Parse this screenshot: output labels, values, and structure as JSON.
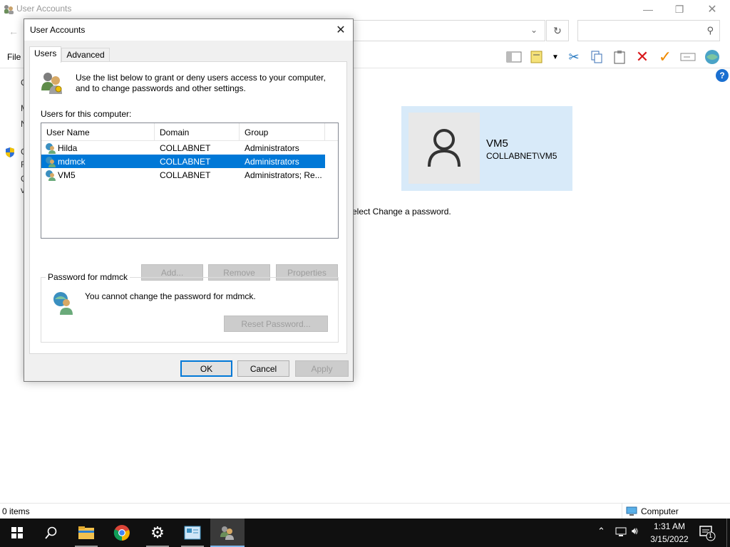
{
  "background_window": {
    "title": "User Accounts",
    "menu_file": "File",
    "user_tile": {
      "name": "VM5",
      "domain": "COLLABNET\\VM5"
    },
    "instruction_fragment": "elect Change a password.",
    "status_items": "0 items",
    "status_location": "Computer",
    "left_clip_chars": [
      "C",
      "M",
      "N",
      "C",
      "F",
      "C",
      "v"
    ]
  },
  "dialog": {
    "title": "User Accounts",
    "tabs": [
      {
        "label": "Users",
        "active": true
      },
      {
        "label": "Advanced",
        "active": false
      }
    ],
    "intro_text": "Use the list below to grant or deny users access to your computer, and to change passwords and other settings.",
    "users_label": "Users for this computer:",
    "columns": [
      "User Name",
      "Domain",
      "Group"
    ],
    "rows": [
      {
        "user": "Hilda",
        "domain": "COLLABNET",
        "group": "Administrators",
        "selected": false
      },
      {
        "user": "mdmck",
        "domain": "COLLABNET",
        "group": "Administrators",
        "selected": true
      },
      {
        "user": "VM5",
        "domain": "COLLABNET",
        "group": "Administrators; Re...",
        "selected": false
      }
    ],
    "buttons": {
      "add": "Add...",
      "remove": "Remove",
      "properties": "Properties"
    },
    "password_group_title": "Password for mdmck",
    "password_text": "You cannot change the password for mdmck.",
    "reset_password": "Reset Password...",
    "footer": {
      "ok": "OK",
      "cancel": "Cancel",
      "apply": "Apply"
    }
  },
  "taskbar": {
    "time": "1:31 AM",
    "date": "3/15/2022",
    "notification_count": "1"
  },
  "colors": {
    "selection": "#0078d7",
    "taskbar": "#101010",
    "tile": "#d8eaf9"
  }
}
